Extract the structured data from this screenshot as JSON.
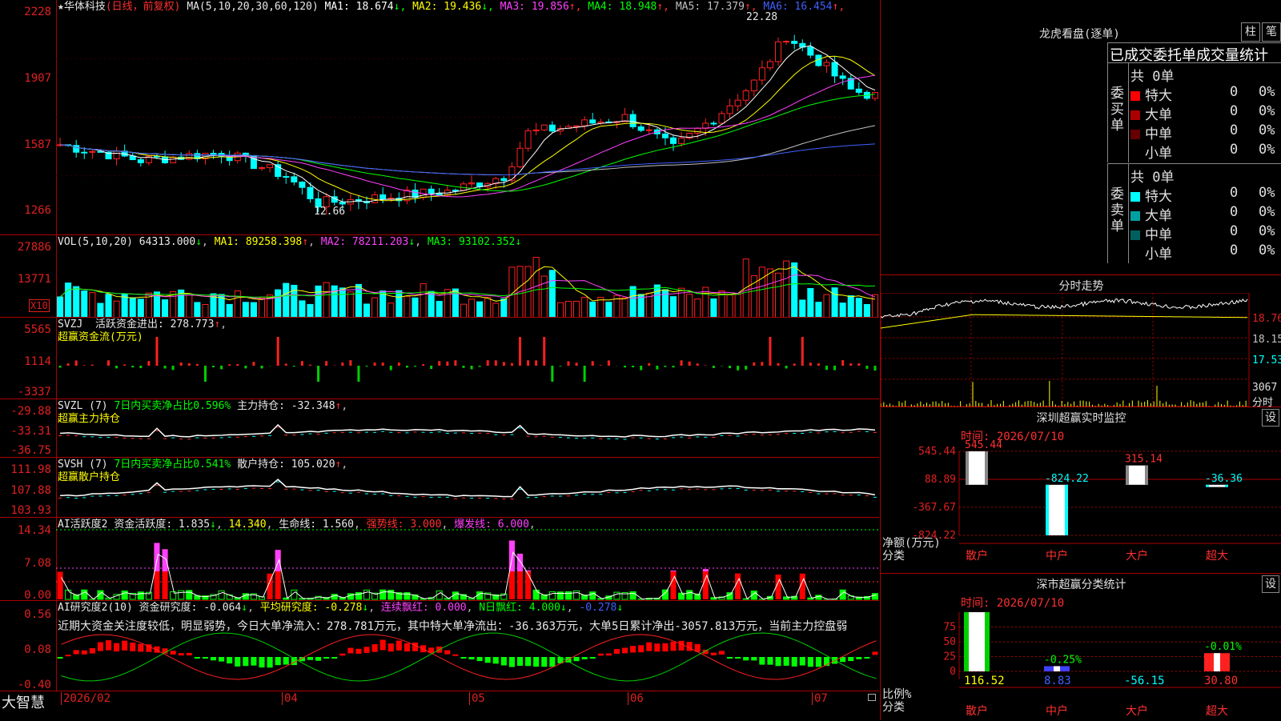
{
  "stock": {
    "name": "华体科技",
    "mode": "(日线，前复权)"
  },
  "main": {
    "ma_params": "MA(5,10,20,30,60,120)",
    "ma": [
      {
        "label": "MA1: 18.674",
        "arrow": "↓",
        "color": "#ffffff"
      },
      {
        "label": "MA2: 19.436",
        "arrow": "↓",
        "color": "#ffff00"
      },
      {
        "label": "MA3: 19.856",
        "arrow": "↑",
        "color": "#ff40ff"
      },
      {
        "label": "MA4: 18.948",
        "arrow": "↑",
        "color": "#00ff00"
      },
      {
        "label": "MA5: 17.379",
        "arrow": "↑",
        "color": "#c0c0c0"
      },
      {
        "label": "MA6: 16.454",
        "arrow": "↑",
        "color": "#4060ff"
      }
    ],
    "yticks": [
      "2228",
      "1907",
      "1587",
      "1266"
    ],
    "high_label": "22.28",
    "low_label": "12.66"
  },
  "vol": {
    "params": "VOL(5,10,20)",
    "value": "64313.000",
    "arrow": "↓",
    "ma1": "MA1: 89258.398",
    "ma1_arrow": "↑",
    "ma2": "MA2: 78211.203",
    "ma2_arrow": "↓",
    "ma3": "MA3: 93102.352",
    "ma3_arrow": "↓",
    "yticks": [
      "27886",
      "13771"
    ],
    "unit": "X10"
  },
  "svzj": {
    "name": "SVZJ",
    "label": "活跃资金进出: 278.773",
    "arrow": "↑",
    "sub": "超赢资金流(万元)",
    "yticks": [
      "5565",
      "1114",
      "-3337"
    ]
  },
  "svzl": {
    "name": "SVZL (7)",
    "ratio": "7日内买卖净占比0.596%",
    "label": "主力持仓: -32.348",
    "arrow": "↑",
    "sub": "超赢主力持仓",
    "yticks": [
      "-29.88",
      "-33.31",
      "-36.75"
    ]
  },
  "svsh": {
    "name": "SVSH (7)",
    "ratio": "7日内买卖净占比0.541%",
    "label": "散户持仓: 105.020",
    "arrow": "↑",
    "sub": "超赢散户持仓",
    "yticks": [
      "111.98",
      "107.88",
      "103.93"
    ]
  },
  "ai1": {
    "name": "AI活跃度2",
    "l1": "资金活跃度: 1.835",
    "a1": "↓",
    "l2": "14.340",
    "l3": "生命线: 1.560",
    "l4": "强势线: 3.000",
    "l5": "爆发线: 6.000",
    "yticks": [
      "14.34",
      "7.08",
      "0.00"
    ]
  },
  "ai2": {
    "name": "AI研究度2(10)",
    "l1": "资金研究度: -0.064",
    "a1": "↓",
    "l2": "平均研究度: -0.278",
    "a2": "↓",
    "l3": "连续飘红: 0.000",
    "l4": "N日飘红: 4.000",
    "a4": "↓",
    "l5": "-0.278",
    "a5": "↓",
    "comment": "近期大资金关注度较低，明显弱势，今日大单净流入：278.781万元，其中特大单净流出：-36.363万元，大单5日累计净出-3057.813万元，当前主力控盘弱",
    "yticks": [
      "0.56",
      "0.08",
      "-0.40"
    ]
  },
  "xaxis": {
    "brand": "大智慧",
    "labels": [
      "2026/02",
      "04",
      "05",
      "06",
      "07"
    ]
  },
  "lhb": {
    "title": "龙虎看盘(逐单)",
    "btn1": "柱",
    "btn2": "笔",
    "tab1": "已成交委托单",
    "tab2": "成交量统计",
    "buy": {
      "side": "委买单",
      "total": "共 0单",
      "rows": [
        {
          "name": "特大",
          "val": "0",
          "pct": "0%",
          "color": "#ff0000"
        },
        {
          "name": "大单",
          "val": "0",
          "pct": "0%",
          "color": "#aa0000"
        },
        {
          "name": "中单",
          "val": "0",
          "pct": "0%",
          "color": "#660000"
        },
        {
          "name": "小单",
          "val": "0",
          "pct": "0%",
          "color": "#000000"
        }
      ]
    },
    "sell": {
      "side": "委卖单",
      "total": "共 0单",
      "rows": [
        {
          "name": "特大",
          "val": "0",
          "pct": "0%",
          "color": "#00ffff"
        },
        {
          "name": "大单",
          "val": "0",
          "pct": "0%",
          "color": "#00a0a0"
        },
        {
          "name": "中单",
          "val": "0",
          "pct": "0%",
          "color": "#006060"
        },
        {
          "name": "小单",
          "val": "0",
          "pct": "0%",
          "color": "#000000"
        }
      ]
    }
  },
  "intraday": {
    "title": "分时走势",
    "yticks": [
      "18.76",
      "18.15",
      "17.53"
    ],
    "vol_tick": "3067",
    "vol_label": "分时"
  },
  "monitor": {
    "title": "深圳超赢实时监控",
    "settings": "设",
    "time": "时间: 2026/07/10",
    "yticks": [
      "545.44",
      "88.89",
      "-367.67",
      "-824.22"
    ],
    "bars": [
      {
        "cat": "散户",
        "value": 545.44,
        "label": "545.44"
      },
      {
        "cat": "中户",
        "value": -824.22,
        "label": "-824.22"
      },
      {
        "cat": "大户",
        "value": 315.14,
        "label": "315.14"
      },
      {
        "cat": "超大",
        "value": -36.36,
        "label": "-36.36"
      }
    ],
    "ylabel": "净额(万元)",
    "xlabel": "分类"
  },
  "classify": {
    "title": "深市超赢分类统计",
    "settings": "设",
    "time": "时间: 2026/07/10",
    "yticks": [
      "75",
      "50",
      "25",
      "0"
    ],
    "bars": [
      {
        "cat": "散户",
        "value": 116.52,
        "pct": ""
      },
      {
        "cat": "中户",
        "value": 8.83,
        "pct": "-0.25%"
      },
      {
        "cat": "大户",
        "value": -56.15,
        "pct": ""
      },
      {
        "cat": "超大",
        "value": 30.8,
        "pct": "-0.01%"
      }
    ],
    "value_labels": [
      "116.52",
      "8.83",
      "-56.15",
      "30.80"
    ],
    "ylabel": "比例%",
    "xlabel": "分类"
  },
  "colors": {
    "up": "#ff2020",
    "down": "#00ffff",
    "grid": "#a00000",
    "axis": "#e02020"
  }
}
